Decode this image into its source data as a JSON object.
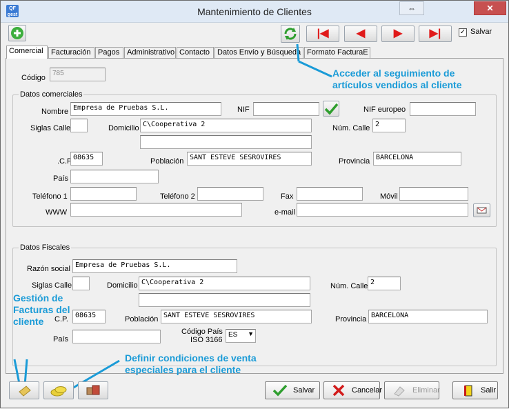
{
  "window": {
    "title": "Mantenimiento de Clientes",
    "app_icon": "QF gest",
    "restore": "⇔",
    "close": "✕"
  },
  "toolbar": {
    "salvar_label": "Salvar",
    "salvar_checked": true
  },
  "tabs": [
    {
      "label": "Comercial",
      "active": true
    },
    {
      "label": "Facturación"
    },
    {
      "label": "Pagos"
    },
    {
      "label": "Administrativo"
    },
    {
      "label": "Contacto"
    },
    {
      "label": "Datos Envío y Búsqueda"
    },
    {
      "label": "Formato FacturaE"
    }
  ],
  "codigo": {
    "label": "Código",
    "value": "785"
  },
  "comerciales": {
    "title": "Datos comerciales",
    "nombre": {
      "label": "Nombre",
      "value": "Empresa de Pruebas S.L."
    },
    "nif": {
      "label": "NIF",
      "value": ""
    },
    "nif_europeo": {
      "label": "NIF europeo",
      "value": ""
    },
    "siglas": {
      "label": "Siglas Calle",
      "value": ""
    },
    "domicilio": {
      "label": "Domicilio",
      "value": "C\\Cooperativa 2",
      "value2": ""
    },
    "num_calle": {
      "label": "Núm. Calle",
      "value": "2"
    },
    "cp": {
      "label": ".C.P.",
      "value": "08635"
    },
    "poblacion": {
      "label": "Población",
      "value": "SANT ESTEVE SESROVIRES"
    },
    "provincia": {
      "label": "Provincia",
      "value": "BARCELONA"
    },
    "pais": {
      "label": "País",
      "value": ""
    },
    "telefono1": {
      "label": "Teléfono 1",
      "value": ""
    },
    "telefono2": {
      "label": "Teléfono 2",
      "value": ""
    },
    "fax": {
      "label": "Fax",
      "value": ""
    },
    "movil": {
      "label": "Móvil",
      "value": ""
    },
    "www": {
      "label": "WWW",
      "value": ""
    },
    "email": {
      "label": "e-mail",
      "value": ""
    }
  },
  "fiscales": {
    "title": "Datos Fiscales",
    "razon": {
      "label": "Razón social",
      "value": "Empresa de Pruebas S.L."
    },
    "siglas": {
      "label": "Siglas Calle",
      "value": ""
    },
    "domicilio": {
      "label": "Domicilio",
      "value": "C\\Cooperativa 2",
      "value2": ""
    },
    "num_calle": {
      "label": "Núm. Calle",
      "value": "2"
    },
    "cp": {
      "label": "C.P.",
      "value": "08635"
    },
    "poblacion": {
      "label": "Población",
      "value": "SANT ESTEVE SESROVIRES"
    },
    "provincia": {
      "label": "Provincia",
      "value": "BARCELONA"
    },
    "pais": {
      "label": "País",
      "value": ""
    },
    "codigo_pais": {
      "label1": "Código País",
      "label2": "ISO 3166",
      "value": "ES"
    }
  },
  "annotations": {
    "seguimiento": [
      "Acceder al seguimiento de",
      "artículos vendidos al cliente"
    ],
    "facturas": [
      "Gestión de",
      "Facturas del",
      "cliente"
    ],
    "condiciones": [
      "Definir condiciones de venta",
      "especiales para el cliente"
    ]
  },
  "buttons": {
    "salvar": "Salvar",
    "cancelar": "Cancelar",
    "eliminar": "Eliminar",
    "salir": "Salir"
  },
  "colors": {
    "annotation": "#1a9bd7",
    "nav_arrow": "#e01a1a",
    "green": "#2e9e2e"
  }
}
